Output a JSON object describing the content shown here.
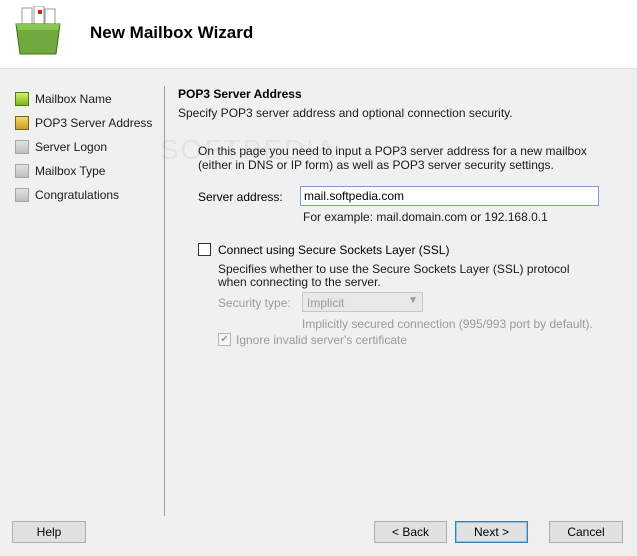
{
  "header": {
    "title": "New Mailbox Wizard",
    "icon": "mailbox-wizard-icon"
  },
  "sidebar": {
    "steps": [
      {
        "label": "Mailbox Name",
        "state": "done"
      },
      {
        "label": "POP3 Server Address",
        "state": "current"
      },
      {
        "label": "Server Logon",
        "state": "pending"
      },
      {
        "label": "Mailbox Type",
        "state": "pending"
      },
      {
        "label": "Congratulations",
        "state": "pending"
      }
    ]
  },
  "page": {
    "title": "POP3 Server Address",
    "subtitle": "Specify POP3 server address and optional connection security.",
    "intro": "On this page you need to input a POP3 server address for a new mailbox (either in DNS or IP form) as well as POP3 server security settings.",
    "server_address_label": "Server address:",
    "server_address_value": "mail.softpedia.com",
    "example": "For example: mail.domain.com or 192.168.0.1",
    "ssl": {
      "label": "Connect using Secure Sockets Layer (SSL)",
      "checked": false,
      "description": "Specifies whether to use the Secure Sockets Layer (SSL) protocol when connecting to the server.",
      "security_type_label": "Security type:",
      "security_type_value": "Implicit",
      "implicit_note": "Implicitly secured connection (995/993 port by default).",
      "ignore_cert_label": "Ignore invalid server's certificate",
      "ignore_cert_checked": true
    }
  },
  "watermark": "SOFTPEDIA",
  "buttons": {
    "help": "Help",
    "back": "< Back",
    "next": "Next >",
    "cancel": "Cancel"
  },
  "colors": {
    "done": "#7ab51d",
    "current": "#caa02a",
    "pending": "#bdbdbd"
  }
}
